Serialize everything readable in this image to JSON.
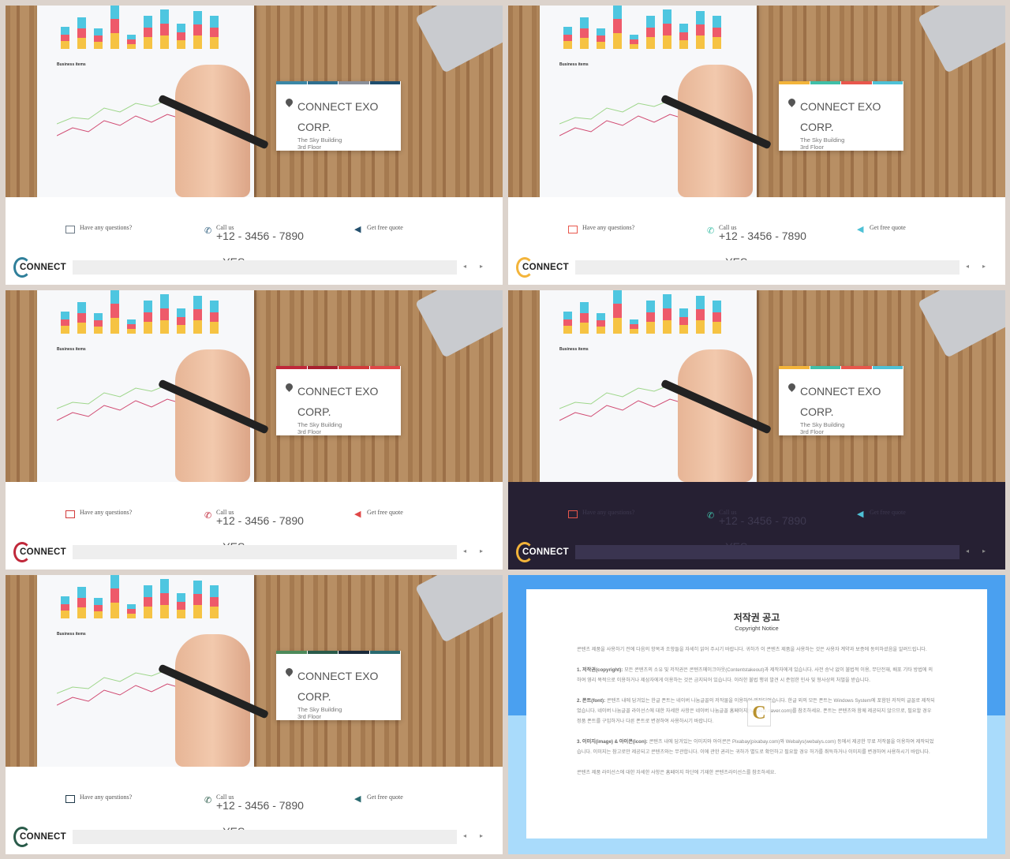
{
  "slides": [
    {
      "card": {
        "line1": "CONNECT EXO",
        "line2": "CORP.",
        "addr1": "The Sky Building",
        "addr2": "3rd Floor",
        "stripes": [
          "#3b87a6",
          "#2f6f8f",
          "#8a8f99",
          "#1f4e6e"
        ]
      },
      "footer": {
        "question": "Have any questions?",
        "call": "Call us",
        "phone": "+12 - 3456 - 7890",
        "yes": "- YES",
        "quote": "Get free quote",
        "logo": "CONNECT",
        "dark": false,
        "icon_colors": [
          "#6d7a86",
          "#2f5f7f",
          "#24506e"
        ],
        "ring": "#2f7f9a"
      }
    },
    {
      "card": {
        "line1": "CONNECT EXO",
        "line2": "CORP.",
        "addr1": "The Sky Building",
        "addr2": "3rd Floor",
        "stripes": [
          "#f3b43a",
          "#3fbfa8",
          "#e8574c",
          "#4ec1d6"
        ]
      },
      "footer": {
        "question": "Have any questions?",
        "call": "Call us",
        "phone": "+12 - 3456 - 7890",
        "yes": "- YES",
        "quote": "Get free quote",
        "logo": "CONNECT",
        "dark": false,
        "icon_colors": [
          "#e8574c",
          "#3fbfa8",
          "#4ec1d6"
        ],
        "ring": "#f3b43a"
      }
    },
    {
      "card": {
        "line1": "CONNECT EXO",
        "line2": "CORP.",
        "addr1": "The Sky Building",
        "addr2": "3rd Floor",
        "stripes": [
          "#c0283a",
          "#a8202f",
          "#d23a3a",
          "#e04848"
        ]
      },
      "footer": {
        "question": "Have any questions?",
        "call": "Call us",
        "phone": "+12 - 3456 - 7890",
        "yes": "- YES",
        "quote": "Get free quote",
        "logo": "CONNECT",
        "dark": false,
        "icon_colors": [
          "#d23a3a",
          "#c0283a",
          "#e04848"
        ],
        "ring": "#c0283a"
      }
    },
    {
      "card": {
        "line1": "CONNECT EXO",
        "line2": "CORP.",
        "addr1": "The Sky Building",
        "addr2": "3rd Floor",
        "stripes": [
          "#f3b43a",
          "#3fbfa8",
          "#e8574c",
          "#4ec1d6"
        ]
      },
      "footer": {
        "question": "Have any questions?",
        "call": "Call us",
        "phone": "+12 - 3456 - 7890",
        "yes": "- YES",
        "quote": "Get free quote",
        "logo": "CONNECT",
        "dark": true,
        "icon_colors": [
          "#e8574c",
          "#3fbfa8",
          "#4ec1d6"
        ],
        "ring": "#f3b43a"
      }
    },
    {
      "card": {
        "line1": "CONNECT EXO",
        "line2": "CORP.",
        "addr1": "The Sky Building",
        "addr2": "3rd Floor",
        "stripes": [
          "#4d8a5a",
          "#2a5b4a",
          "#1a2a3a",
          "#2a6a70"
        ]
      },
      "footer": {
        "question": "Have any questions?",
        "call": "Call us",
        "phone": "+12 - 3456 - 7890",
        "yes": "- YES",
        "quote": "Get free quote",
        "logo": "CONNECT",
        "dark": false,
        "icon_colors": [
          "#1f3a4a",
          "#2a5b4a",
          "#2a6a70"
        ],
        "ring": "#2a5b4a"
      }
    }
  ],
  "photo_label": "Business items",
  "copyright": {
    "title": "저작권 공고",
    "subtitle": "Copyright Notice",
    "intro": "콘텐츠 제품을 사용하기 전에 다음의 항목과 조항들을 자세히 읽어 주시기 바랍니다. 귀하가 이 콘텐츠 제품을 사용하는 것은 사용자 계약과 보증에 동의하셨음을 알려드립니다.",
    "s1_head": "1. 저작권(copyright):",
    "s1": "모든 콘텐츠의 소유 및 저작권은 콘텐츠메이크아웃(Contentstakeout)과 제작자에게 있습니다. 사전 승낙 없이 불법적 이용, 무단전재, 배포 기타 방법에 의하여 영리 목적으로 이용하거나 제삼자에게 이용하는 것은 금지되어 있습니다. 이러한 불법 행위 발견 시 준엄한 민사 및 형사상의 처벌을 받습니다.",
    "s2_head": "2. 폰트(font):",
    "s2": "콘텐츠 내에 담겨있는 한글 폰트는 네이버 나눔글꼴의 저작물을 이용하여 제작되었습니다. 한글 외의 모든 폰트는 Windows System에 포함된 저작의 글꼴로 제작되었습니다. 네이버 나눔글꼴 라이선스에 대한 자세한 사항은 네이버 나눔글꼴 홈페이지(hangeul.naver.com)를 참조하세요. 폰트는 콘텐츠와 함께 제공되지 않으므로, 필요할 경우 정품 폰트를 구입하거나 다른 폰트로 변경하여 사용하시기 바랍니다.",
    "s3_head": "3. 이미지(image) & 아이콘(icon):",
    "s3": "콘텐츠 내에 담겨있는 이미지와 아이콘은 Pixabay(pixabay.com)와 Webalys(webalys.com) 등에서 제공한 무료 저작물을 이용하여 제작되었습니다. 이미지는 참고로만 제공되고 콘텐츠와는 무관합니다. 이에 관한 권리는 귀하가 별도로 확인하고 필요할 경우 허가를 취득하거나 이미지를 변경하여 사용하시기 바랍니다.",
    "outro": "콘텐츠 제품 라이선스에 대한 자세한 사항은 홈페이지 하단에 기재한 콘텐츠라이선스를 참조하세요.",
    "watermark": "C"
  }
}
